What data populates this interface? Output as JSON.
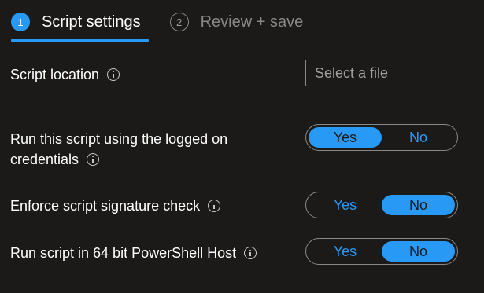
{
  "steps": [
    {
      "number": "1",
      "label": "Script settings",
      "active": true
    },
    {
      "number": "2",
      "label": "Review + save",
      "active": false
    }
  ],
  "script_location": {
    "label": "Script location",
    "placeholder": "Select a file"
  },
  "settings": [
    {
      "label_line1": "Run this script using the logged on",
      "label_line2": "credentials",
      "yes": "Yes",
      "no": "No",
      "selected": "Yes"
    },
    {
      "label": "Enforce script signature check",
      "yes": "Yes",
      "no": "No",
      "selected": "No"
    },
    {
      "label": "Run script in 64 bit PowerShell Host",
      "yes": "Yes",
      "no": "No",
      "selected": "No"
    }
  ],
  "colors": {
    "accent": "#2899f5",
    "background": "#1b1a19",
    "border": "#8a8886"
  }
}
